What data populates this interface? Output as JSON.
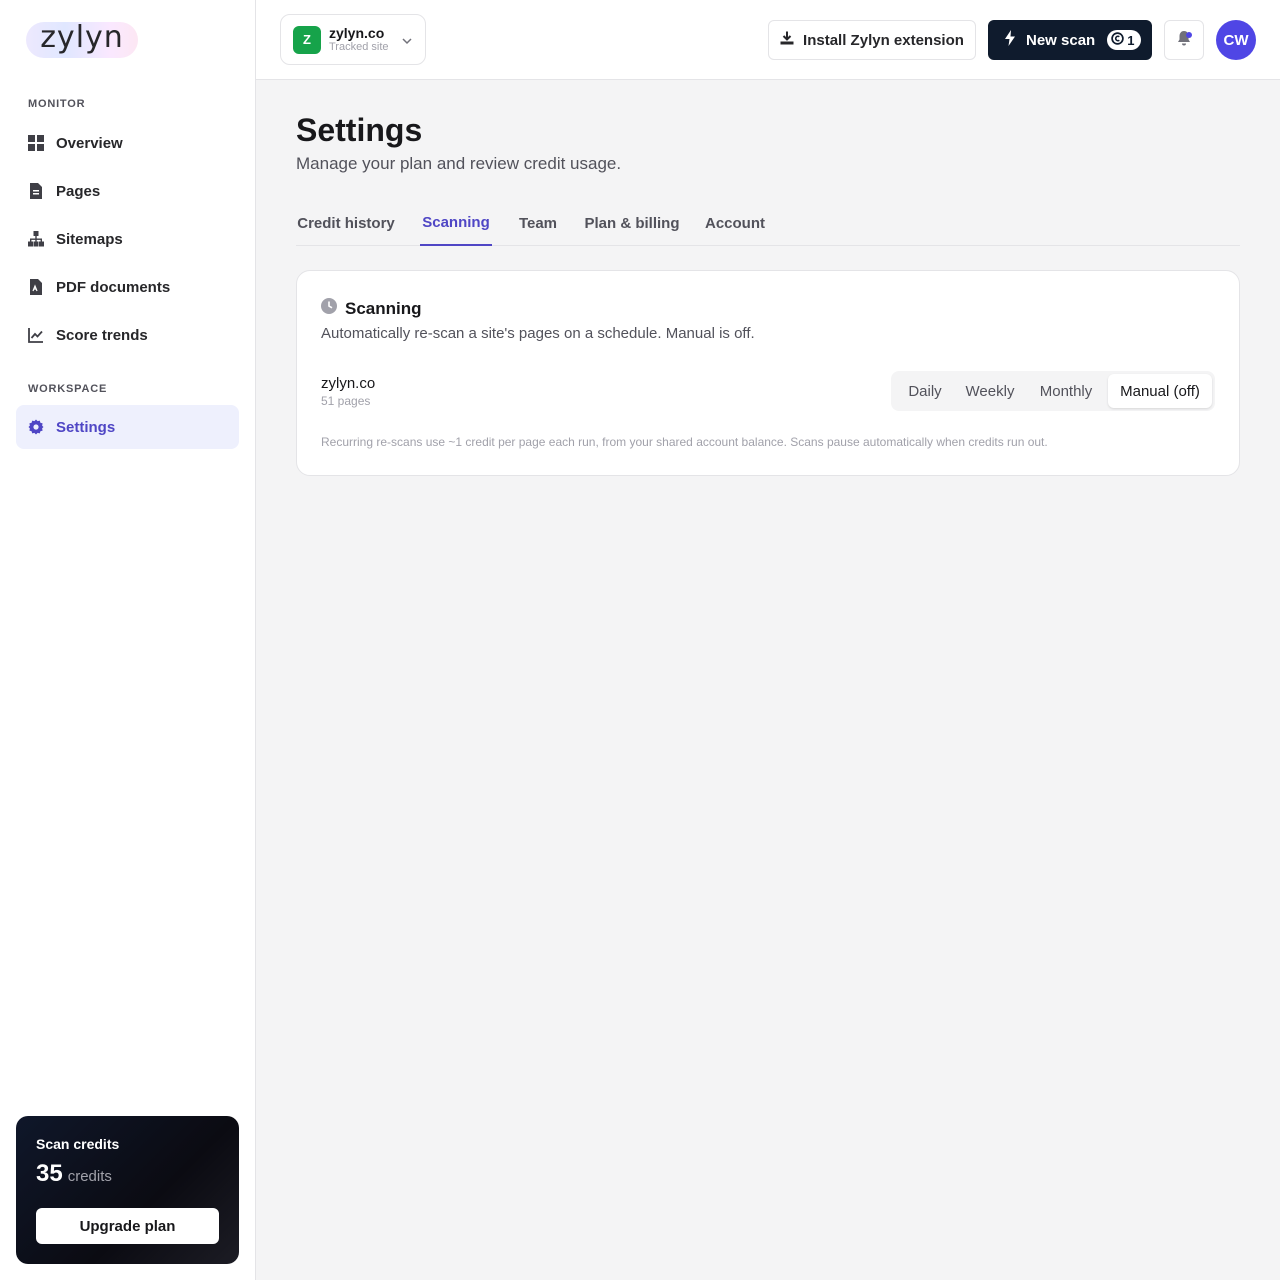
{
  "brand": {
    "logo_text": "zylyn"
  },
  "sidebar": {
    "sections": [
      {
        "label": "MONITOR"
      },
      {
        "label": "WORKSPACE"
      }
    ],
    "items": [
      {
        "label": "Overview",
        "icon": "grid-icon"
      },
      {
        "label": "Pages",
        "icon": "file-icon"
      },
      {
        "label": "Sitemaps",
        "icon": "sitemap-icon"
      },
      {
        "label": "PDF documents",
        "icon": "pdf-icon"
      },
      {
        "label": "Score trends",
        "icon": "chart-line-icon"
      },
      {
        "label": "Settings",
        "icon": "gear-icon",
        "active": true
      }
    ],
    "credits": {
      "title": "Scan credits",
      "value": "35",
      "unit": "credits",
      "upgrade_label": "Upgrade plan"
    }
  },
  "topbar": {
    "site": {
      "badge": "Z",
      "name": "zylyn.co",
      "subtitle": "Tracked site"
    },
    "install_label": "Install Zylyn extension",
    "new_scan_label": "New scan",
    "new_scan_cost": "1",
    "avatar_initials": "CW"
  },
  "page": {
    "title": "Settings",
    "subtitle": "Manage your plan and review credit usage.",
    "tabs": [
      {
        "label": "Credit history"
      },
      {
        "label": "Scanning",
        "active": true
      },
      {
        "label": "Team"
      },
      {
        "label": "Plan & billing"
      },
      {
        "label": "Account"
      }
    ]
  },
  "scanning": {
    "title": "Scanning",
    "description": "Automatically re-scan a site's pages on a schedule. Manual is off.",
    "site_name": "zylyn.co",
    "site_pages": "51 pages",
    "options": [
      {
        "label": "Daily"
      },
      {
        "label": "Weekly"
      },
      {
        "label": "Monthly"
      },
      {
        "label": "Manual (off)",
        "active": true
      }
    ],
    "footnote": "Recurring re-scans use ~1 credit per page each run, from your shared account balance. Scans pause automatically when credits run out."
  },
  "colors": {
    "accent": "#4f46c5",
    "primary_dark": "#0f1b2d",
    "site_badge": "#16a34a",
    "avatar": "#4f46e5"
  }
}
